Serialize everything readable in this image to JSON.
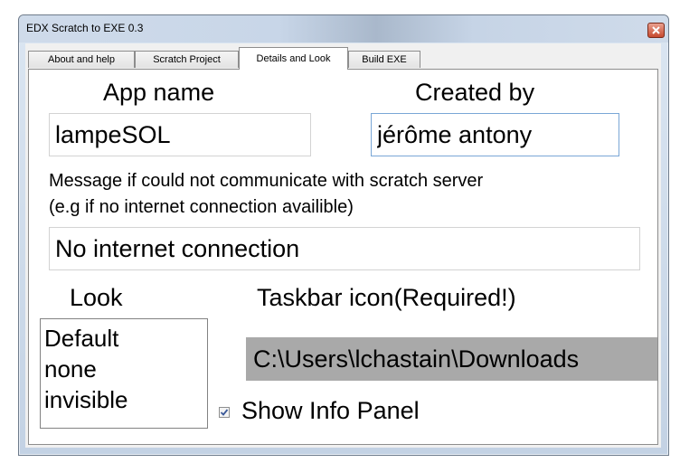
{
  "window": {
    "title": "EDX Scratch to EXE 0.3"
  },
  "tabs": [
    {
      "label": "About and help"
    },
    {
      "label": "Scratch Project"
    },
    {
      "label": "Details and Look"
    },
    {
      "label": "Build EXE"
    }
  ],
  "active_tab": "Details and Look",
  "details": {
    "app_name_label": "App name",
    "app_name_value": "lampeSOL",
    "created_by_label": "Created by",
    "created_by_value": "jérôme antony",
    "message_label_line1": "Message if could not communicate with scratch server",
    "message_label_line2": "(e.g if no internet connection availible)",
    "message_value": "No internet connection",
    "look_label": "Look",
    "look_options": [
      "Default",
      "none",
      "invisible"
    ],
    "taskbar_icon_label": "Taskbar icon(Required!)",
    "taskbar_icon_path": "C:\\Users\\lchastain\\Downloads",
    "show_info_panel_label": "Show Info Panel",
    "show_info_panel_checked": true
  },
  "colors": {
    "path_box_bg": "#a9a9a9",
    "close_button": "#c74a2f"
  }
}
